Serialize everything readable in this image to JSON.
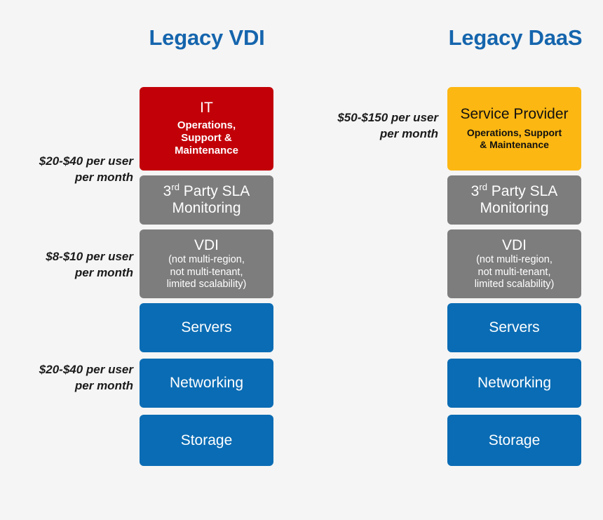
{
  "background_color": "#f5f5f5",
  "palette": {
    "heading_blue": "#1565ad",
    "it_red": "#c20008",
    "service_provider_gold": "#fcb712",
    "gray": "#7d7d7d",
    "infrastructure_blue": "#0a6cb4",
    "label_text": "#1b1b1b"
  },
  "columns": [
    {
      "id": "legacy-vdi",
      "heading": "Legacy VDI",
      "boxes": [
        {
          "id": "it",
          "title": "IT",
          "subtitle": "Operations, Support & Maintenance",
          "subtitle_lines": [
            "Operations,",
            "Support &",
            "Maintenance"
          ],
          "color": "#c20008"
        },
        {
          "id": "sla",
          "title_prefix": "3",
          "title_ordinal": "rd",
          "title_suffix": " Party SLA",
          "title_line2": "Monitoring",
          "title": "3rd Party SLA Monitoring",
          "color": "#7d7d7d"
        },
        {
          "id": "vdi",
          "title": "VDI",
          "subtitle": "(not multi-region, not multi-tenant, limited scalability)",
          "subtitle_lines": [
            "(not multi-region,",
            "not multi-tenant,",
            "limited scalability)"
          ],
          "color": "#7d7d7d"
        },
        {
          "id": "servers",
          "title": "Servers",
          "color": "#0a6cb4"
        },
        {
          "id": "networking",
          "title": "Networking",
          "color": "#0a6cb4"
        },
        {
          "id": "storage",
          "title": "Storage",
          "color": "#0a6cb4"
        }
      ]
    },
    {
      "id": "legacy-daas",
      "heading": "Legacy DaaS",
      "boxes": [
        {
          "id": "service-provider",
          "title": "Service Provider",
          "subtitle": "Operations, Support & Maintenance",
          "subtitle_lines": [
            "Operations, Support",
            "& Maintenance"
          ],
          "color": "#fcb712"
        },
        {
          "id": "sla",
          "title_prefix": "3",
          "title_ordinal": "rd",
          "title_suffix": " Party SLA",
          "title_line2": "Monitoring",
          "title": "3rd Party SLA Monitoring",
          "color": "#7d7d7d"
        },
        {
          "id": "vdi",
          "title": "VDI",
          "subtitle": "(not multi-region, not multi-tenant, limited scalability)",
          "subtitle_lines": [
            "(not multi-region,",
            "not multi-tenant,",
            "limited scalability)"
          ],
          "color": "#7d7d7d"
        },
        {
          "id": "servers",
          "title": "Servers",
          "color": "#0a6cb4"
        },
        {
          "id": "networking",
          "title": "Networking",
          "color": "#0a6cb4"
        },
        {
          "id": "storage",
          "title": "Storage",
          "color": "#0a6cb4"
        }
      ]
    }
  ],
  "price_labels": {
    "left": [
      {
        "id": "it-layer",
        "line1": "$20-$40 per user",
        "line2": "per month"
      },
      {
        "id": "vdi-layer",
        "line1": "$8-$10 per user",
        "line2": "per month"
      },
      {
        "id": "infrastructure",
        "line1": "$20-$40 per user",
        "line2": "per month"
      }
    ],
    "right": [
      {
        "id": "service-provider-layer",
        "line1": "$50-$150 per user",
        "line2": "per month"
      }
    ]
  }
}
